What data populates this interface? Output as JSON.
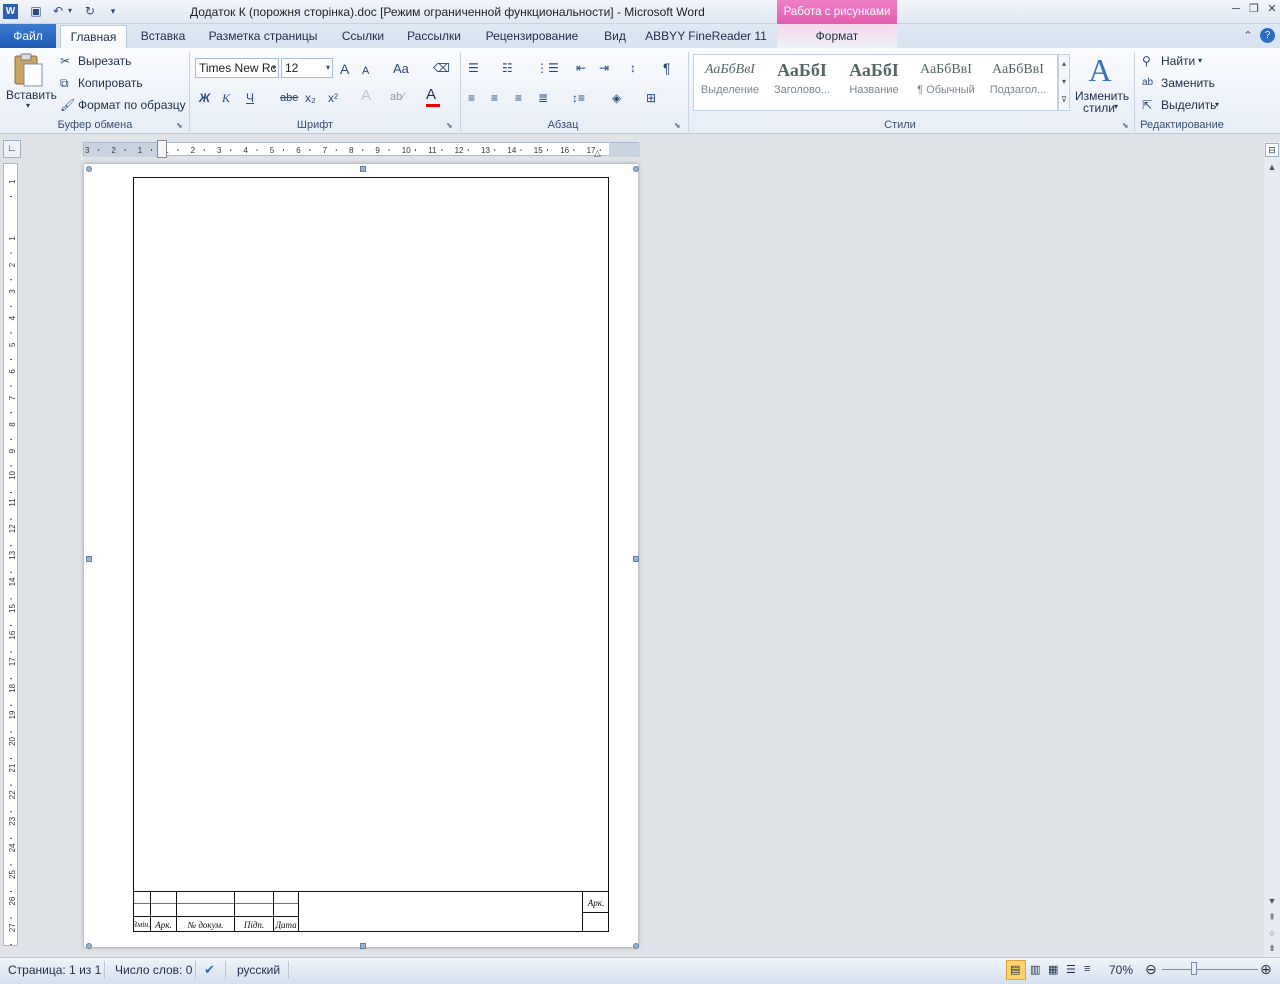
{
  "window": {
    "title": "Додаток К (порожня сторінка).doc [Режим ограниченной функциональности]  -  Microsoft Word",
    "context_header": "Работа с рисунками"
  },
  "tabs": {
    "file": "Файл",
    "items": [
      "Главная",
      "Вставка",
      "Разметка страницы",
      "Ссылки",
      "Рассылки",
      "Рецензирование",
      "Вид",
      "ABBYY FineReader 11",
      "Формат"
    ]
  },
  "ribbon": {
    "clipboard": {
      "paste": "Вставить",
      "cut": "Вырезать",
      "copy": "Копировать",
      "format_painter": "Формат по образцу",
      "label": "Буфер обмена"
    },
    "font": {
      "font_name": "Times New Rc",
      "font_size": "12",
      "label": "Шрифт",
      "bold": "Ж",
      "italic": "К",
      "underline": "Ч",
      "strike": "abe",
      "subscript": "x₂",
      "superscript": "x²",
      "grow": "A",
      "shrink": "A",
      "change_case": "Aa",
      "color": "A"
    },
    "paragraph": {
      "label": "Абзац",
      "pilcrow": "¶"
    },
    "styles": {
      "label": "Стили",
      "items": [
        {
          "sample": "АаБбВвІ",
          "name": "Выделение"
        },
        {
          "sample": "АаБбІ",
          "name": "Заголово..."
        },
        {
          "sample": "АаБбІ",
          "name": "Название"
        },
        {
          "sample": "АаБбВвІ",
          "name": "¶ Обычный"
        },
        {
          "sample": "АаБбВвІ",
          "name": "Подзагол..."
        }
      ],
      "change_styles_line1": "Изменить",
      "change_styles_line2": "стили"
    },
    "editing": {
      "label": "Редактирование",
      "find": "Найти",
      "replace": "Заменить",
      "select": "Выделить"
    }
  },
  "ruler": {
    "h_numbers": [
      "3",
      "2",
      "1",
      "1",
      "2",
      "3",
      "4",
      "5",
      "6",
      "7",
      "8",
      "9",
      "10",
      "11",
      "12",
      "13",
      "14",
      "15",
      "16",
      "17"
    ],
    "v_numbers": [
      "1",
      "1",
      "2",
      "3",
      "4",
      "5",
      "6",
      "7",
      "8",
      "9",
      "10",
      "11",
      "12",
      "13",
      "14",
      "15",
      "16",
      "17",
      "18",
      "19",
      "20",
      "21",
      "22",
      "23",
      "24",
      "25",
      "26",
      "27"
    ]
  },
  "title_block": {
    "zmin": "Змін.",
    "ark": "Арк.",
    "ndoc": "№ докум.",
    "pidp": "Підп.",
    "data": "Дата",
    "ark_right": "Арк."
  },
  "status": {
    "page": "Страница: 1 из 1",
    "words": "Число слов: 0",
    "language": "русский",
    "zoom": "70%"
  }
}
